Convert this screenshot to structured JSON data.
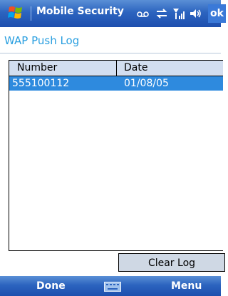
{
  "titlebar": {
    "app_title": "Mobile Security",
    "ok_label": "ok"
  },
  "page": {
    "title": "WAP Push Log"
  },
  "list": {
    "columns": [
      "Number",
      "Date"
    ],
    "rows": [
      {
        "number": "555100112",
        "date": "01/08/05"
      }
    ]
  },
  "actions": {
    "clear_log": "Clear Log"
  },
  "softkeys": {
    "left": "Done",
    "right": "Menu"
  },
  "colors": {
    "titlebar": "#2c64bf",
    "selection": "#2e8ade",
    "accent_text": "#2a9fe0",
    "header": "#d2def0"
  },
  "icons": [
    "start-flag-icon",
    "voicemail-icon",
    "sync-icon",
    "signal-icon",
    "speaker-icon",
    "keyboard-icon"
  ]
}
